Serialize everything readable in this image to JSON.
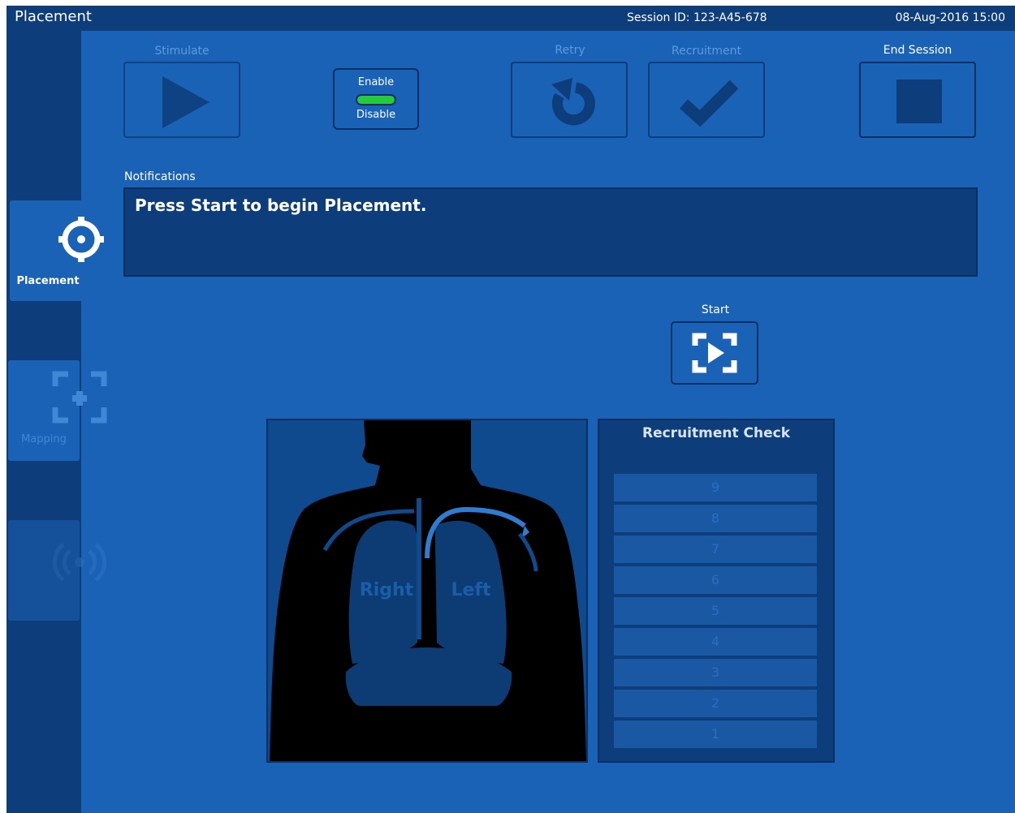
{
  "header": {
    "title": "Placement",
    "session": "Session ID: 123-A45-678",
    "datetime": "08-Aug-2016  15:00"
  },
  "sidebar": {
    "items": [
      {
        "label": "Placement",
        "icon": "crosshair-icon",
        "active": true
      },
      {
        "label": "Mapping",
        "icon": "add-frame-icon",
        "active": false
      },
      {
        "label": "",
        "icon": "signal-waves-icon",
        "active": false
      }
    ]
  },
  "toolbar": {
    "stimulate_label": "Stimulate",
    "retry_label": "Retry",
    "recruitment_label": "Recruitment",
    "end_session_label": "End Session",
    "enable_label": "Enable",
    "disable_label": "Disable",
    "toggle_state_color": "#27c93f"
  },
  "notifications": {
    "label": "Notifications",
    "message": "Press Start to begin Placement."
  },
  "start": {
    "label": "Start"
  },
  "diagram": {
    "right_label": "Right",
    "left_label": "Left"
  },
  "recruitment_check": {
    "title": "Recruitment Check",
    "levels": [
      "9",
      "8",
      "7",
      "6",
      "5",
      "4",
      "3",
      "2",
      "1"
    ]
  },
  "colors": {
    "background": "#1a62b5",
    "bar": "#0d3d7a",
    "accent_green": "#27c93f"
  }
}
